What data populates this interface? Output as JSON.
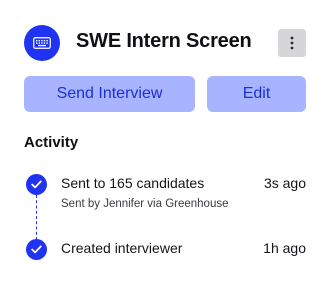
{
  "header": {
    "app_icon": "keyboard-icon",
    "title": "SWE Intern Screen",
    "more_icon": "more-vertical-icon"
  },
  "actions": {
    "send_label": "Send Interview",
    "edit_label": "Edit"
  },
  "activity": {
    "title": "Activity",
    "items": [
      {
        "text": "Sent to 165 candidates",
        "sub": "Sent by Jennifer via Greenhouse",
        "time": "3s ago",
        "icon": "check-circle-icon"
      },
      {
        "text": "Created interviewer",
        "time": "1h ago",
        "icon": "check-circle-icon"
      }
    ]
  },
  "colors": {
    "accent": "#1f33f0",
    "button_bg": "#a8b4ff",
    "button_text": "#1b2fd6",
    "more_bg": "#d6d6d9"
  }
}
